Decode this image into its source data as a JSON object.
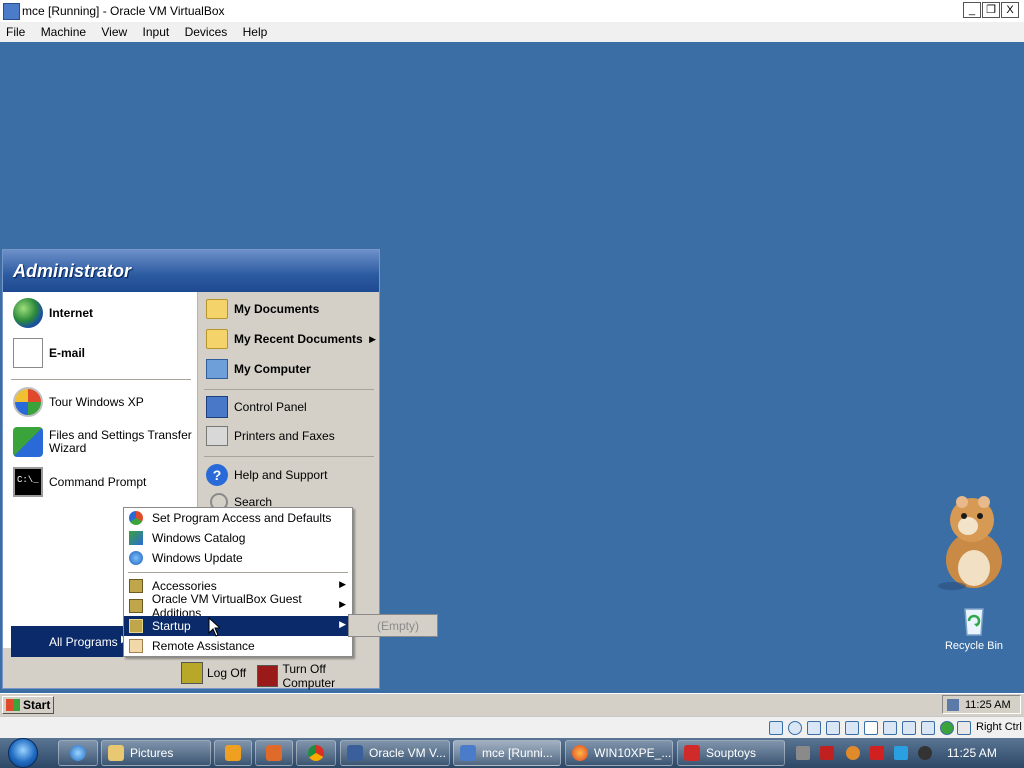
{
  "host_window": {
    "title": "mce [Running] - Oracle VM VirtualBox",
    "controls": {
      "minimize": "_",
      "restore": "❐",
      "close": "X"
    },
    "menu": [
      "File",
      "Machine",
      "View",
      "Input",
      "Devices",
      "Help"
    ]
  },
  "start_menu": {
    "user": "Administrator",
    "pinned": [
      {
        "label": "Internet",
        "icon": "internet-explorer-icon"
      },
      {
        "label": "E-mail",
        "icon": "email-icon"
      }
    ],
    "recent": [
      {
        "label": "Tour Windows XP",
        "icon": "tour-icon"
      },
      {
        "label": "Files and Settings Transfer Wizard",
        "icon": "transfer-wizard-icon"
      },
      {
        "label": "Command Prompt",
        "icon": "command-prompt-icon",
        "glyph": "C:\\_"
      }
    ],
    "right": {
      "my_documents": "My Documents",
      "my_recent_documents": "My Recent Documents",
      "my_computer": "My Computer",
      "control_panel": "Control Panel",
      "printers": "Printers and Faxes",
      "help": "Help and Support",
      "search": "Search"
    },
    "all_programs": "All Programs",
    "log_off": "Log Off",
    "turn_off": "Turn Off Computer"
  },
  "programs_menu": {
    "items": [
      {
        "label": "Set Program Access and Defaults",
        "arrow": false
      },
      {
        "label": "Windows Catalog",
        "arrow": false
      },
      {
        "label": "Windows Update",
        "arrow": false
      },
      {
        "label": "Accessories",
        "arrow": true
      },
      {
        "label": "Oracle VM VirtualBox Guest Additions",
        "arrow": true
      },
      {
        "label": "Startup",
        "arrow": true,
        "highlighted": true
      },
      {
        "label": "Remote Assistance",
        "arrow": false
      }
    ],
    "startup_submenu": "(Empty)"
  },
  "desktop": {
    "recycle_bin": "Recycle Bin"
  },
  "guest_taskbar": {
    "start": "Start",
    "clock": "11:25 AM"
  },
  "vbox_status": {
    "host_key": "Right Ctrl"
  },
  "host_taskbar": {
    "buttons": [
      {
        "label": "Pictures",
        "icon": "folder-icon"
      },
      {
        "label": "Oracle VM V...",
        "icon": "virtualbox-icon"
      },
      {
        "label": "mce [Runni...",
        "icon": "vm-window-icon"
      },
      {
        "label": "WIN10XPE_...",
        "icon": "firefox-icon"
      },
      {
        "label": "Souptoys",
        "icon": "souptoys-icon"
      }
    ],
    "clock": "11:25 AM"
  },
  "colors": {
    "desktop": "#3a6ea5",
    "start_header": "#2c5aa0",
    "highlight": "#0b2a6a"
  }
}
